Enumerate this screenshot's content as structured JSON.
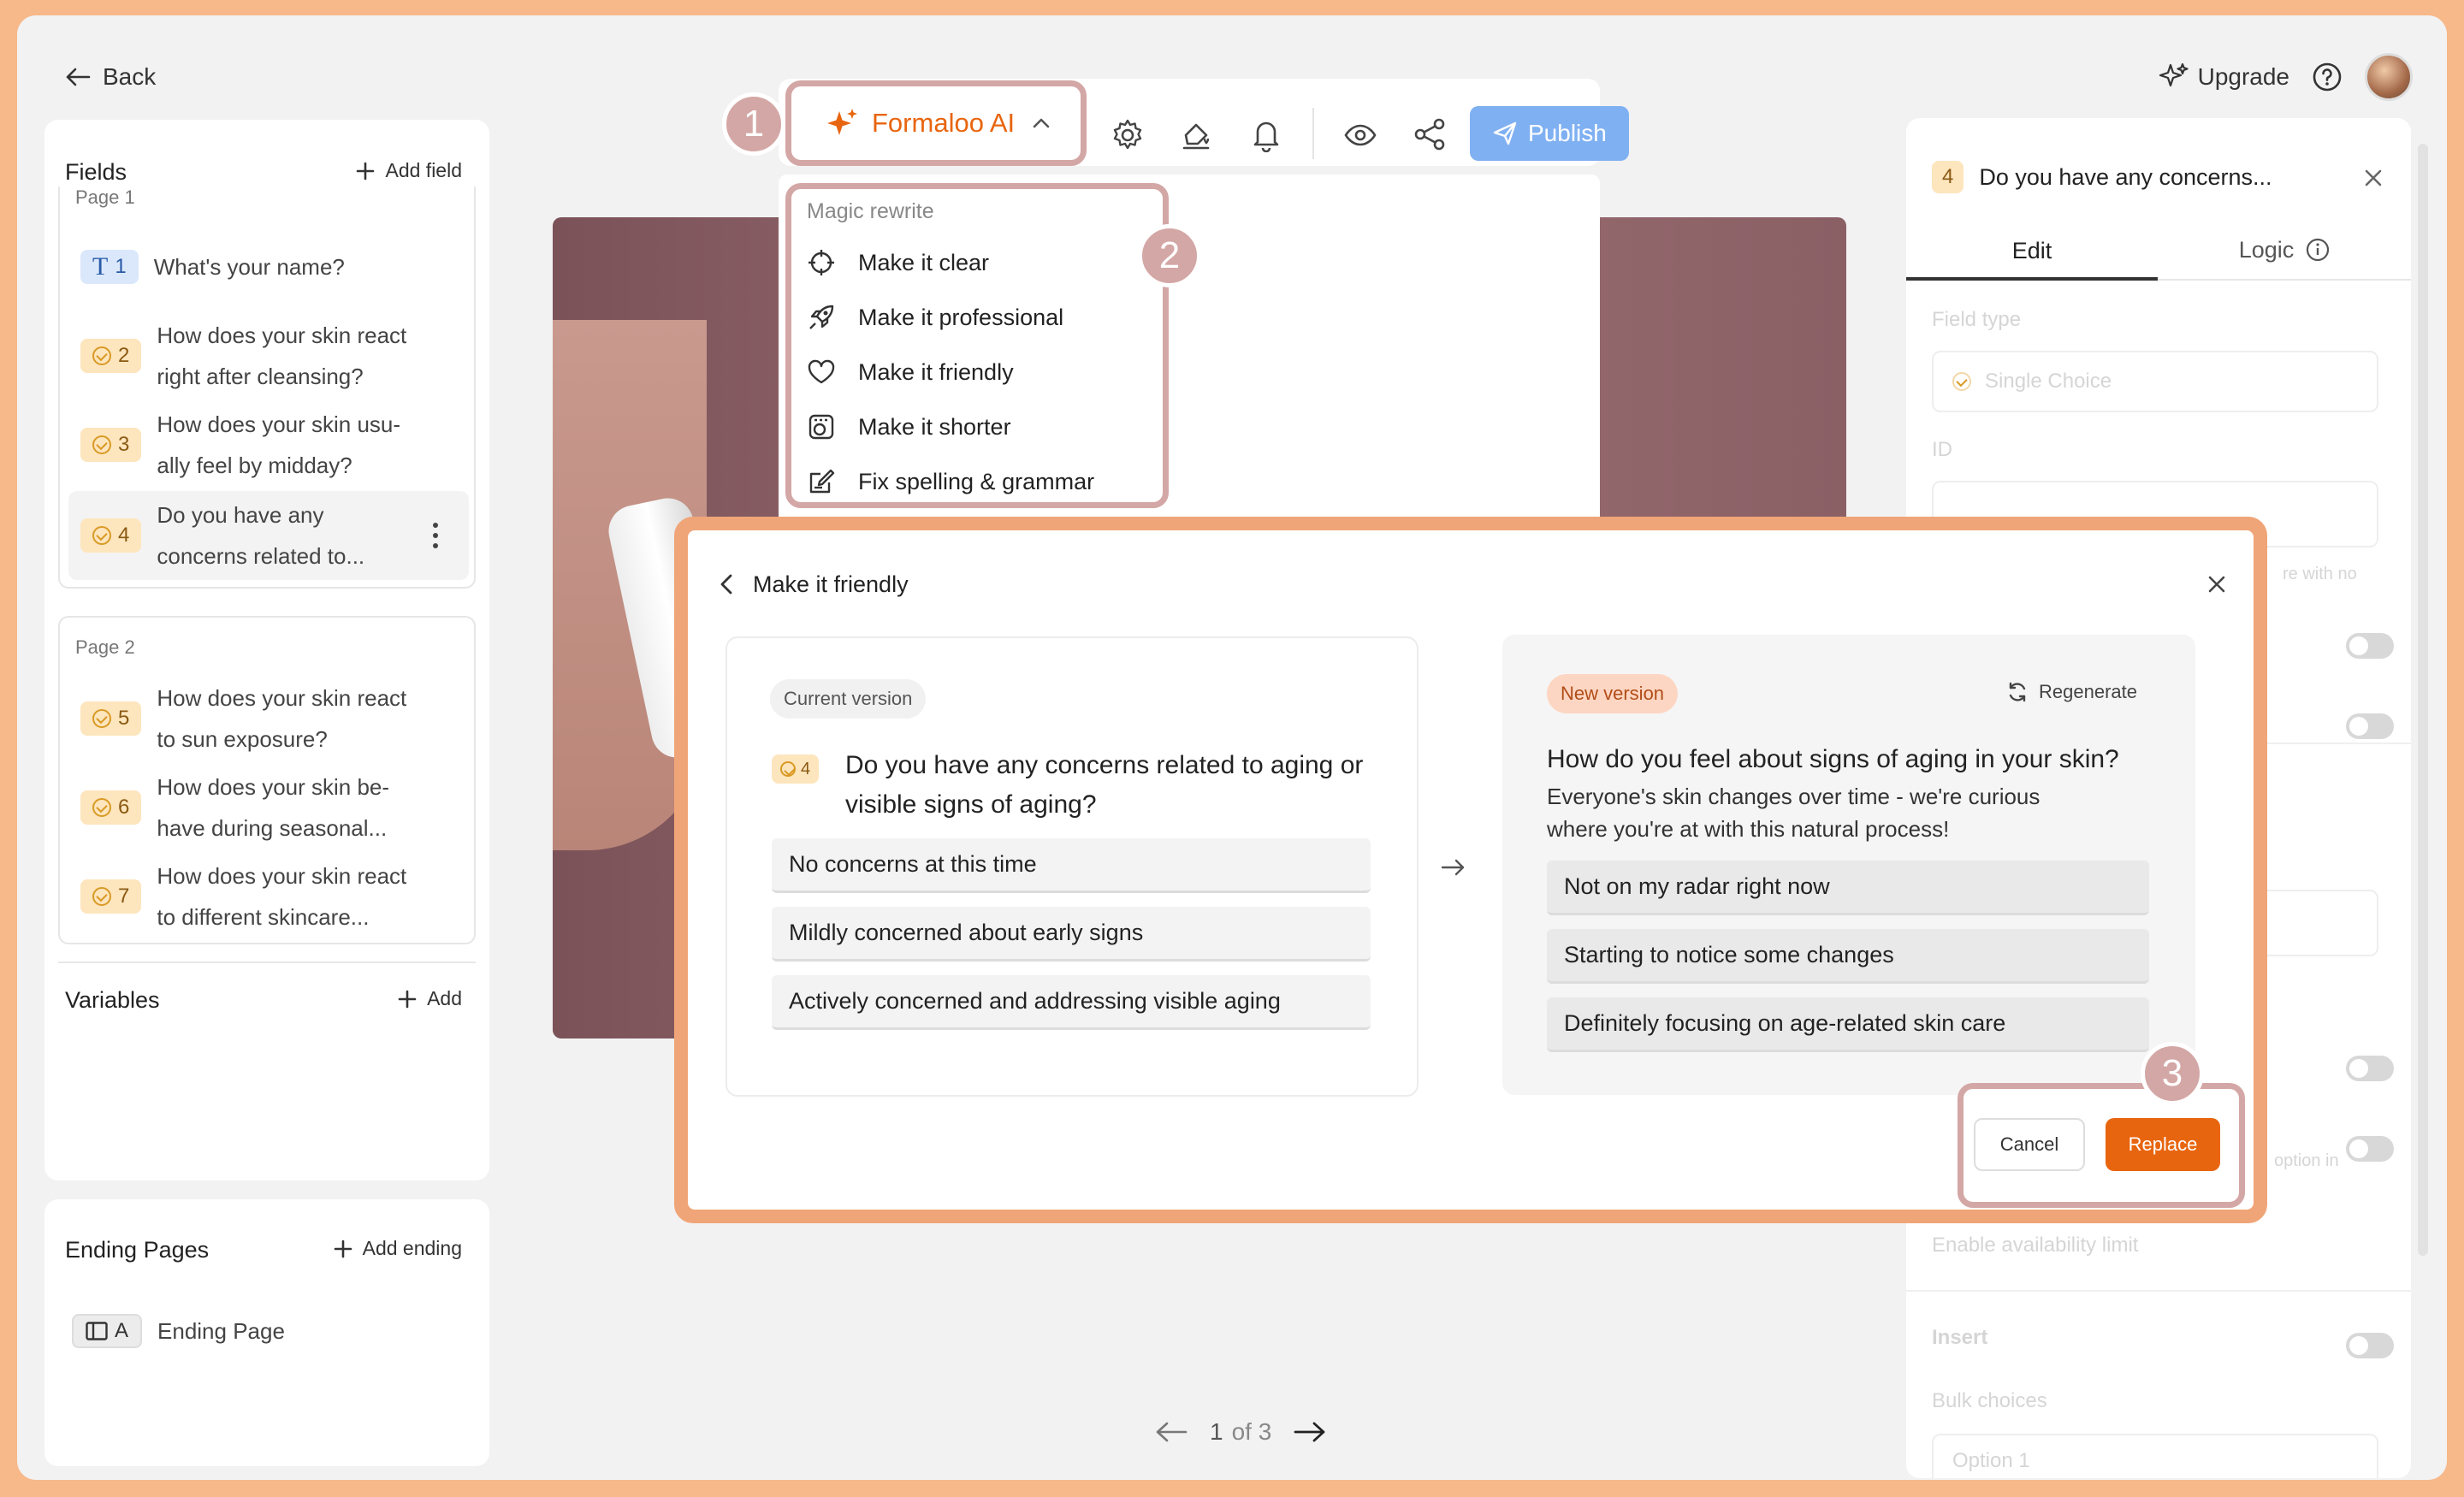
{
  "topbar": {
    "back_label": "Back",
    "upgrade_label": "Upgrade"
  },
  "fields_panel": {
    "title": "Fields",
    "add_label": "Add field",
    "pages": [
      {
        "label": "Page 1",
        "questions": [
          {
            "num": "1",
            "type": "text",
            "line1": "What's your name?",
            "line2": ""
          },
          {
            "num": "2",
            "type": "choice",
            "line1": "How does your skin react",
            "line2": "right after cleansing?"
          },
          {
            "num": "3",
            "type": "choice",
            "line1": "How does your skin usu-",
            "line2": "ally feel by midday?"
          },
          {
            "num": "4",
            "type": "choice",
            "line1": "Do you have any",
            "line2": "concerns related to..."
          }
        ]
      },
      {
        "label": "Page 2",
        "questions": [
          {
            "num": "5",
            "type": "choice",
            "line1": "How does your skin react",
            "line2": "to sun exposure?"
          },
          {
            "num": "6",
            "type": "choice",
            "line1": "How does your skin be-",
            "line2": "have during seasonal..."
          },
          {
            "num": "7",
            "type": "choice",
            "line1": "How does your skin react",
            "line2": "to different skincare..."
          }
        ]
      }
    ]
  },
  "variables_panel": {
    "title": "Variables",
    "add_label": "Add"
  },
  "ending_panel": {
    "title": "Ending Pages",
    "add_label": "Add ending",
    "item_badge": "A",
    "item_label": "Ending Page"
  },
  "toolbar": {
    "ai_label": "Formaloo AI",
    "publish_label": "Publish",
    "step1": "1"
  },
  "dropdown": {
    "section": "Magic rewrite",
    "step2": "2",
    "items": [
      {
        "label": "Make it clear",
        "icon": "crosshair-icon"
      },
      {
        "label": "Make it professional",
        "icon": "rocket-icon"
      },
      {
        "label": "Make it friendly",
        "icon": "heart-icon"
      },
      {
        "label": "Make it shorter",
        "icon": "shorten-icon"
      },
      {
        "label": "Fix spelling & grammar",
        "icon": "edit-check-icon"
      }
    ]
  },
  "right_panel": {
    "field_num": "4",
    "field_title": "Do you have any concerns...",
    "tab_edit": "Edit",
    "tab_logic": "Logic",
    "field_type_label": "Field type",
    "field_type_value": "Single Choice",
    "id_label": "ID",
    "hint1": "re with no",
    "hint2": "option in",
    "availability_label": "Enable availability limit",
    "insert_label": "Insert",
    "bulk_label": "Bulk choices",
    "option_placeholder": "Option 1"
  },
  "modal": {
    "title": "Make it friendly",
    "current": {
      "pill": "Current version",
      "num": "4",
      "question": "Do you have any concerns related to aging or visible signs of aging?",
      "options": [
        "No concerns at this time",
        "Mildly concerned about early signs",
        "Actively concerned and addressing visible aging"
      ]
    },
    "new": {
      "pill": "New version",
      "regenerate_label": "Regenerate",
      "question": "How do you feel about signs of aging in your skin?",
      "description": "Everyone's skin changes over time - we're curious where you're at with this natural process!",
      "options": [
        "Not on my radar right now",
        "Starting to notice some changes",
        "Definitely focusing on age-related skin care"
      ]
    },
    "cancel_label": "Cancel",
    "replace_label": "Replace",
    "step3": "3"
  },
  "pager": {
    "current": "1",
    "total_text": "of 3"
  },
  "colors": {
    "accent": "#e8650f",
    "annotation": "#d3a7a5",
    "modal_border": "#f0a578",
    "publish": "#7fb0f2"
  }
}
